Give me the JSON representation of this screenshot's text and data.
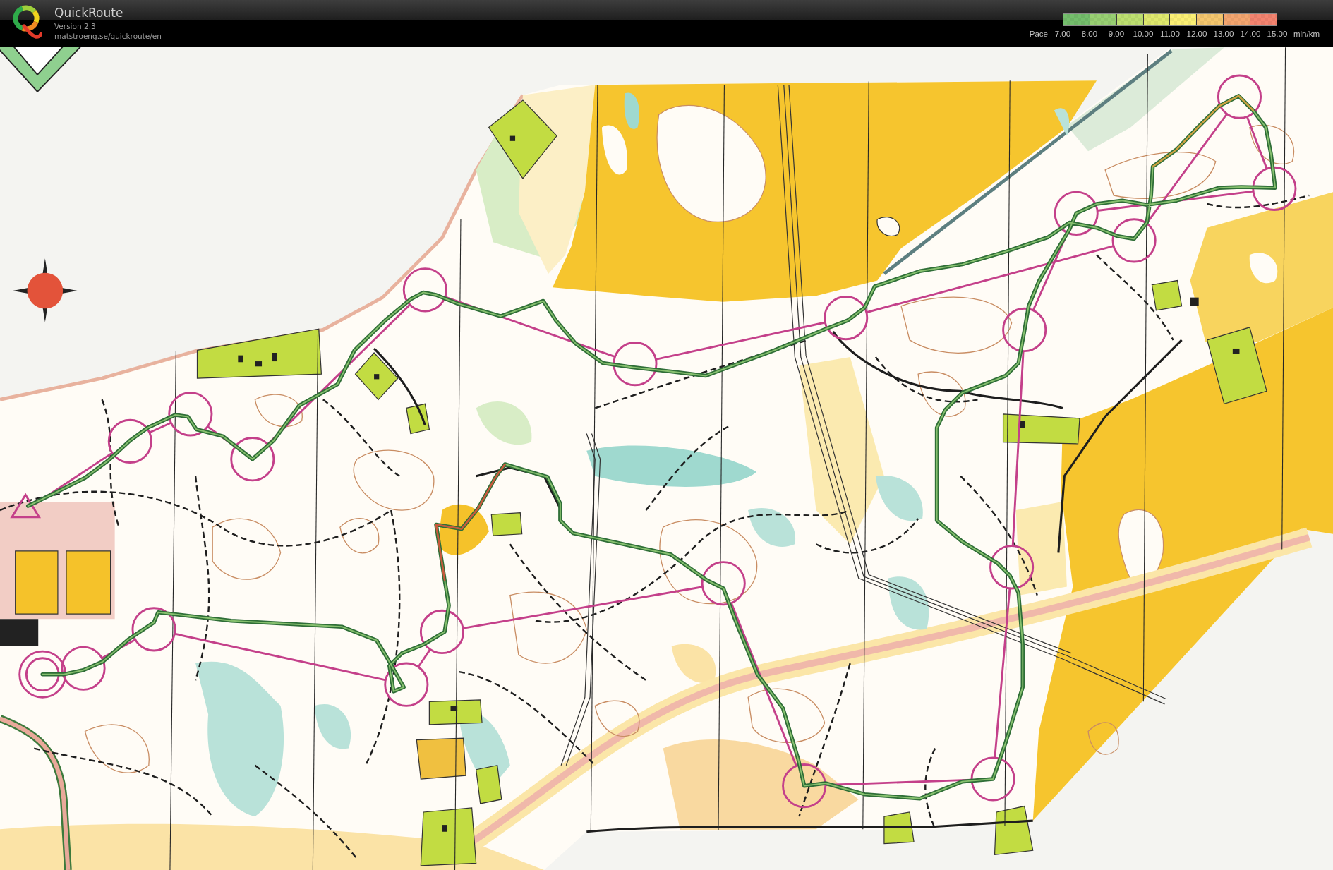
{
  "app": {
    "title": "QuickRoute",
    "version": "Version 2.3",
    "url": "matstroeng.se/quickroute/en"
  },
  "pace_legend": {
    "label": "Pace",
    "segments": [
      {
        "color": "#74be6c"
      },
      {
        "color": "#98cf72"
      },
      {
        "color": "#bddf70"
      },
      {
        "color": "#dfe96e"
      },
      {
        "color": "#fbef74"
      },
      {
        "color": "#f4c66e"
      },
      {
        "color": "#f3a56f"
      },
      {
        "color": "#f3836f"
      }
    ],
    "ticks": [
      "7.00",
      "8.00",
      "9.00",
      "10.00",
      "11.00",
      "12.00",
      "13.00",
      "14.00",
      "15.00"
    ],
    "unit": "min/km"
  }
}
